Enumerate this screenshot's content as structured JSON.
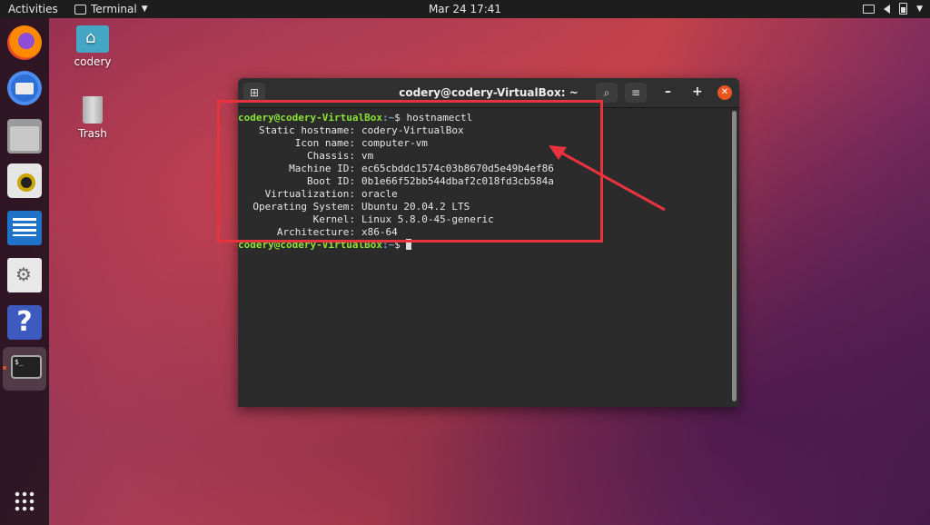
{
  "topbar": {
    "activities": "Activities",
    "app_menu": "Terminal",
    "clock": "Mar 24  17:41",
    "icons": [
      "network-icon",
      "volume-icon",
      "battery-icon",
      "system-menu-caret"
    ]
  },
  "dock": {
    "items": [
      "firefox",
      "thunderbird",
      "files",
      "rhythmbox",
      "libreoffice-writer",
      "software",
      "help",
      "terminal",
      "show-applications"
    ],
    "terminal_label": "$_"
  },
  "desktop": {
    "icons": [
      {
        "label": "codery",
        "icon": "home-folder-icon"
      },
      {
        "label": "Trash",
        "icon": "trash-icon"
      }
    ]
  },
  "terminal": {
    "title": "codery@codery-VirtualBox: ~",
    "prompt_user": "codery@codery-VirtualBox",
    "prompt_path": ":~",
    "prompt_symbol": "$ ",
    "command": "hostnamectl",
    "output": [
      {
        "label": "Static hostname:",
        "value": "codery-VirtualBox"
      },
      {
        "label": "Icon name:",
        "value": "computer-vm"
      },
      {
        "label": "Chassis:",
        "value": "vm"
      },
      {
        "label": "Machine ID:",
        "value": "ec65cbddc1574c03b8670d5e49b4ef86"
      },
      {
        "label": "Boot ID:",
        "value": "0b1e66f52bb544dbaf2c018fd3cb584a"
      },
      {
        "label": "Virtualization:",
        "value": "oracle"
      },
      {
        "label": "Operating System:",
        "value": "Ubuntu 20.04.2 LTS"
      },
      {
        "label": "Kernel:",
        "value": "Linux 5.8.0-45-generic"
      },
      {
        "label": "Architecture:",
        "value": "x86-64"
      }
    ]
  },
  "colors": {
    "annotation": "#e8333f",
    "prompt_user": "#8ae234",
    "prompt_path": "#729fcf",
    "close_button": "#e95420"
  }
}
